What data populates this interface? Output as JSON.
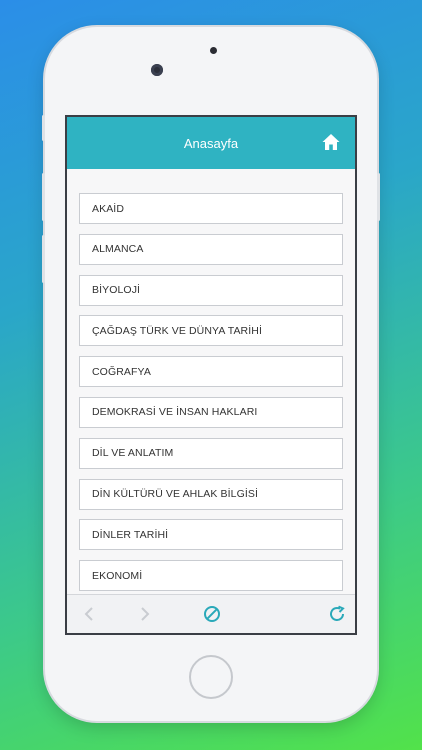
{
  "header": {
    "title": "Anasayfa",
    "home_icon": "home-icon"
  },
  "list": {
    "items": [
      "AKAİD",
      "ALMANCA",
      "BİYOLOJİ",
      "ÇAĞDAŞ TÜRK VE DÜNYA TARİHİ",
      "COĞRAFYA",
      "DEMOKRASİ VE İNSAN HAKLARI",
      "DİL VE ANLATIM",
      "DİN KÜLTÜRÜ VE AHLAK BİLGİSİ",
      "DİNLER TARİHİ",
      "EKONOMİ"
    ]
  },
  "toolbar": {
    "back_icon": "chevron-left-icon",
    "forward_icon": "chevron-right-icon",
    "stop_icon": "stop-icon",
    "reload_icon": "reload-icon"
  },
  "colors": {
    "accent": "#2fb3c2",
    "toolbar_icon_active": "#2aa9b9",
    "toolbar_icon_disabled": "#c9ccd1"
  }
}
